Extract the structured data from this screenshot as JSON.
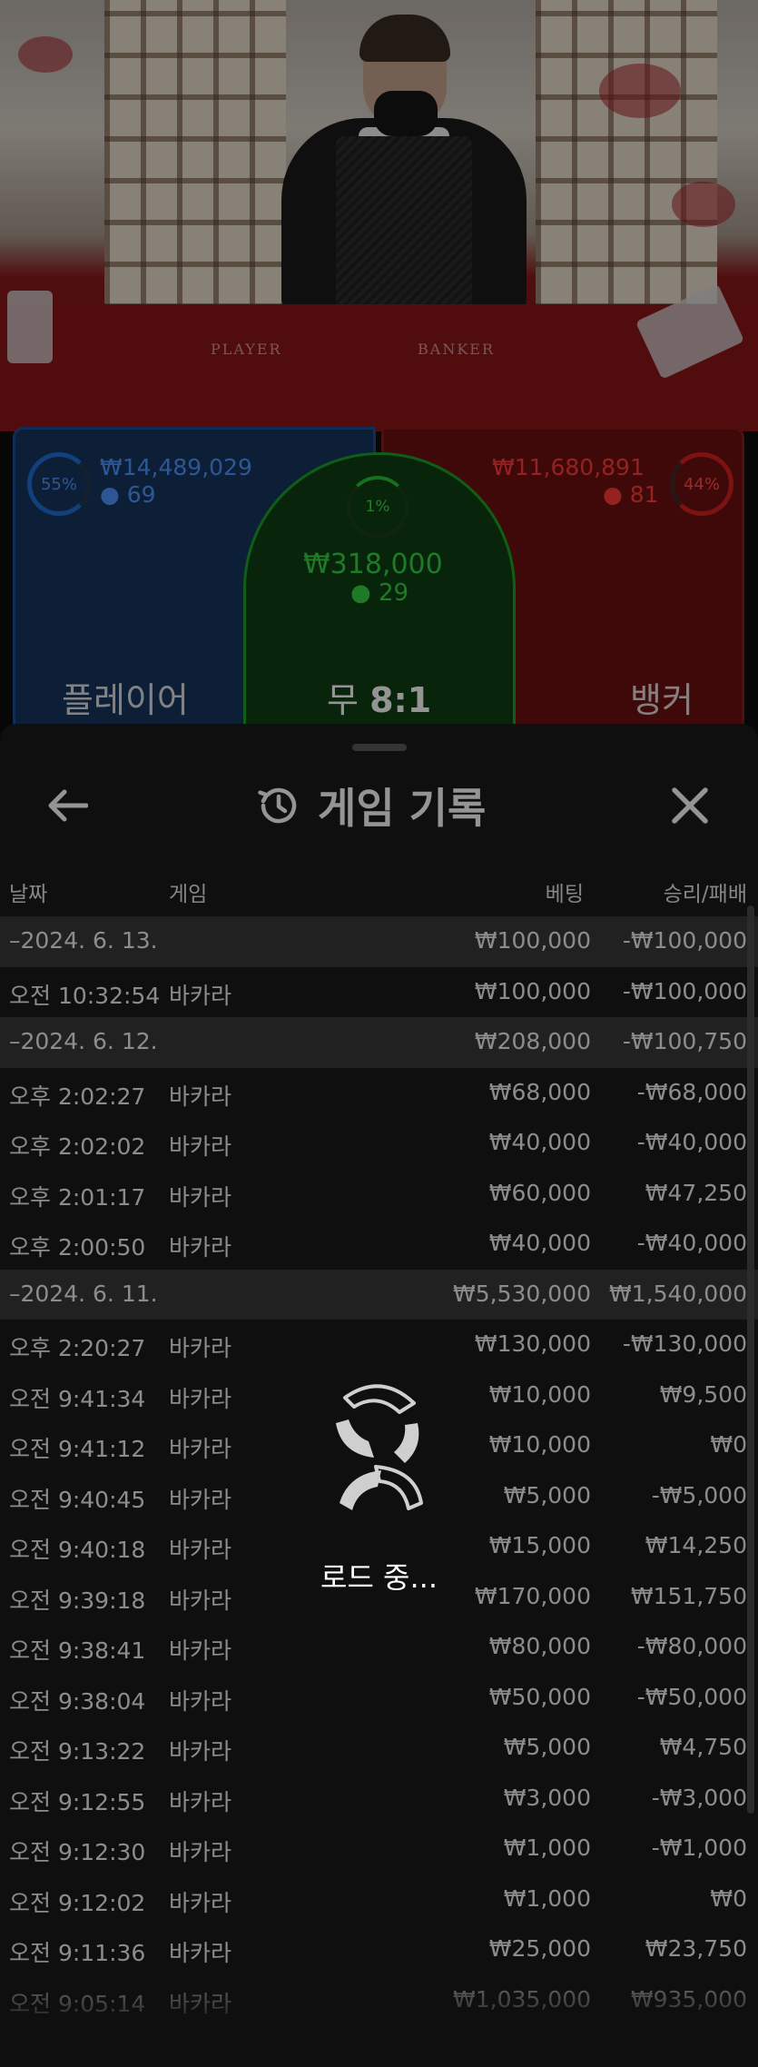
{
  "game_scene": {
    "felt_player": "PLAYER",
    "felt_banker": "BANKER",
    "player": {
      "percent": "55%",
      "amount": "₩14,489,029",
      "count": "69",
      "label": "플레이어"
    },
    "tie": {
      "percent": "1%",
      "amount": "₩318,000",
      "count": "29",
      "label": "무",
      "payout": "8:1"
    },
    "banker": {
      "percent": "44%",
      "amount": "₩11,680,891",
      "count": "81",
      "label": "뱅커"
    }
  },
  "modal": {
    "title": "게임 기록",
    "icons": {
      "back": "arrow-left-icon",
      "history": "history-clock-icon",
      "close": "close-icon"
    },
    "columns": {
      "date": "날짜",
      "game": "게임",
      "bet": "베팅",
      "result": "승리/패배"
    },
    "rows": [
      {
        "type": "date",
        "date": "–2024. 6. 13.",
        "game": "",
        "bet": "₩100,000",
        "result": "-₩100,000"
      },
      {
        "type": "entry",
        "date": "오전 10:32:54",
        "game": "바카라",
        "bet": "₩100,000",
        "result": "-₩100,000"
      },
      {
        "type": "date",
        "date": "–2024. 6. 12.",
        "game": "",
        "bet": "₩208,000",
        "result": "-₩100,750"
      },
      {
        "type": "entry",
        "date": "오후 2:02:27",
        "game": "바카라",
        "bet": "₩68,000",
        "result": "-₩68,000"
      },
      {
        "type": "entry",
        "date": "오후 2:02:02",
        "game": "바카라",
        "bet": "₩40,000",
        "result": "-₩40,000"
      },
      {
        "type": "entry",
        "date": "오후 2:01:17",
        "game": "바카라",
        "bet": "₩60,000",
        "result": "₩47,250"
      },
      {
        "type": "entry",
        "date": "오후 2:00:50",
        "game": "바카라",
        "bet": "₩40,000",
        "result": "-₩40,000"
      },
      {
        "type": "date",
        "date": "–2024. 6. 11.",
        "game": "",
        "bet": "₩5,530,000",
        "result": "₩1,540,000"
      },
      {
        "type": "entry",
        "date": "오후 2:20:27",
        "game": "바카라",
        "bet": "₩130,000",
        "result": "-₩130,000"
      },
      {
        "type": "entry",
        "date": "오전 9:41:34",
        "game": "바카라",
        "bet": "₩10,000",
        "result": "₩9,500"
      },
      {
        "type": "entry",
        "date": "오전 9:41:12",
        "game": "바카라",
        "bet": "₩10,000",
        "result": "₩0"
      },
      {
        "type": "entry",
        "date": "오전 9:40:45",
        "game": "바카라",
        "bet": "₩5,000",
        "result": "-₩5,000"
      },
      {
        "type": "entry",
        "date": "오전 9:40:18",
        "game": "바카라",
        "bet": "₩15,000",
        "result": "₩14,250"
      },
      {
        "type": "entry",
        "date": "오전 9:39:18",
        "game": "바카라",
        "bet": "₩170,000",
        "result": "₩151,750"
      },
      {
        "type": "entry",
        "date": "오전 9:38:41",
        "game": "바카라",
        "bet": "₩80,000",
        "result": "-₩80,000"
      },
      {
        "type": "entry",
        "date": "오전 9:38:04",
        "game": "바카라",
        "bet": "₩50,000",
        "result": "-₩50,000"
      },
      {
        "type": "entry",
        "date": "오전 9:13:22",
        "game": "바카라",
        "bet": "₩5,000",
        "result": "₩4,750"
      },
      {
        "type": "entry",
        "date": "오전 9:12:55",
        "game": "바카라",
        "bet": "₩3,000",
        "result": "-₩3,000"
      },
      {
        "type": "entry",
        "date": "오전 9:12:30",
        "game": "바카라",
        "bet": "₩1,000",
        "result": "-₩1,000"
      },
      {
        "type": "entry",
        "date": "오전 9:12:02",
        "game": "바카라",
        "bet": "₩1,000",
        "result": "₩0"
      },
      {
        "type": "entry",
        "date": "오전 9:11:36",
        "game": "바카라",
        "bet": "₩25,000",
        "result": "₩23,750"
      },
      {
        "type": "entry",
        "date": "오전 9:05:14",
        "game": "바카라",
        "bet": "₩1,035,000",
        "result": "₩935,000"
      }
    ]
  },
  "loading": {
    "text": "로드 중...",
    "icon": "loading-spinner-icon"
  },
  "colors": {
    "player_blue": "#1f6fd6",
    "banker_red": "#d61f1f",
    "tie_green": "#27c233",
    "modal_bg": "#1b1b1c",
    "date_row_bg": "#3a3a3a"
  }
}
